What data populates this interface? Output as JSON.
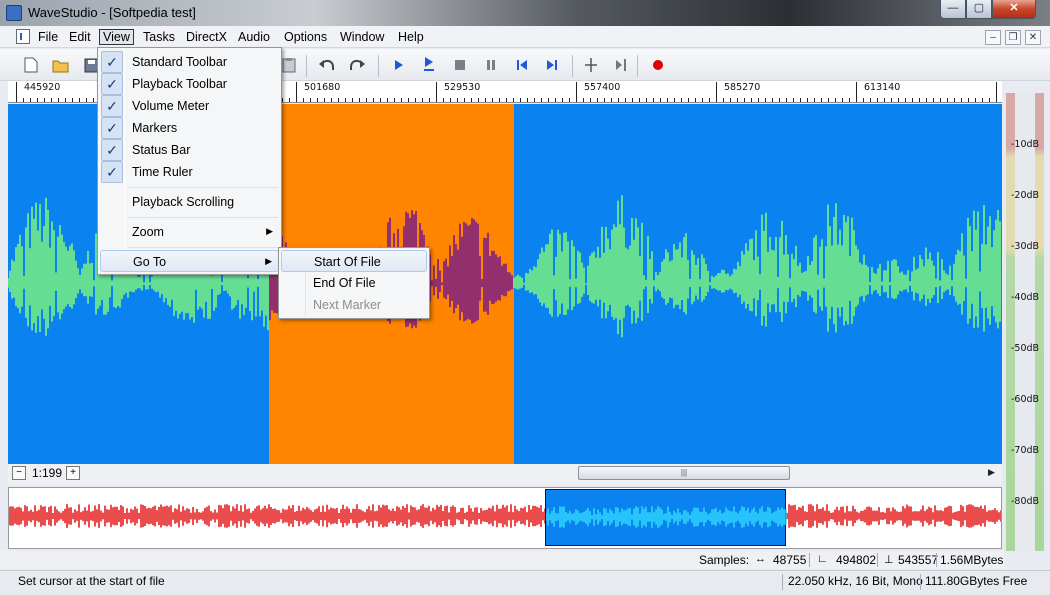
{
  "window": {
    "title": "WaveStudio - [Softpedia test]",
    "minimize_glyph": "—",
    "maximize_glyph": "▢",
    "close_glyph": "✕"
  },
  "menubar": {
    "items": [
      "File",
      "Edit",
      "View",
      "Tasks",
      "DirectX",
      "Audio",
      "Options",
      "Window",
      "Help"
    ],
    "active": "View",
    "mdi_minimize": "–",
    "mdi_restore": "❐",
    "mdi_close": "✕"
  },
  "toolbar": {
    "icons": [
      "new-icon",
      "open-icon",
      "save-icon",
      "paste-icon",
      "undo-icon",
      "redo-icon",
      "play-icon",
      "play-loop-icon",
      "stop-icon",
      "pause-icon",
      "skip-start-icon",
      "skip-end-icon",
      "split-icon",
      "cursor-end-icon",
      "record-icon"
    ],
    "record_color": "#e00000"
  },
  "ruler": {
    "labels": [
      "445920",
      "501680",
      "529530",
      "557400",
      "585270",
      "613140"
    ]
  },
  "view_menu": {
    "items": [
      {
        "label": "Standard Toolbar",
        "checked": true
      },
      {
        "label": "Playback Toolbar",
        "checked": true
      },
      {
        "label": "Volume Meter",
        "checked": true
      },
      {
        "label": "Markers",
        "checked": true
      },
      {
        "label": "Status Bar",
        "checked": true
      },
      {
        "label": "Time Ruler",
        "checked": true
      },
      {
        "label": "Playback Scrolling",
        "checked": false
      },
      {
        "label": "Zoom",
        "checked": false,
        "submenu": true
      },
      {
        "label": "Go To",
        "checked": false,
        "submenu": true,
        "highlighted": true
      }
    ],
    "check_glyph": "✓",
    "submenu_glyph": "▶"
  },
  "goto_menu": {
    "items": [
      {
        "label": "Start Of File",
        "highlighted": true,
        "enabled": true
      },
      {
        "label": "End Of File",
        "highlighted": false,
        "enabled": true
      },
      {
        "label": "Next Marker",
        "highlighted": false,
        "enabled": false
      }
    ]
  },
  "meter": {
    "labels": [
      "-10dB",
      "-20dB",
      "-30dB",
      "-40dB",
      "-50dB",
      "-60dB",
      "-70dB",
      "-80dB"
    ]
  },
  "zoom": {
    "level": "1:199",
    "zoom_out_glyph": "−",
    "zoom_in_glyph": "+",
    "scroll_grip": "|||",
    "scroll_arrow": "▶"
  },
  "samples": {
    "label": "Samples:",
    "selection_length": "48755",
    "selection_start": "494802",
    "selection_end": "543557",
    "memory": "1.56MBytes"
  },
  "status": {
    "message": "Set cursor at the start of file",
    "format": "22.050 kHz, 16 Bit, Mono",
    "free": "111.80GBytes Free"
  },
  "colors": {
    "wave_background": "#0a82f0",
    "selection_background": "#ff8400",
    "wave_color": "#7cf57c",
    "selected_wave_color": "#7a1a8a",
    "overview_wave_color": "#e00000",
    "overview_view_wave_color": "#33e0ff"
  }
}
